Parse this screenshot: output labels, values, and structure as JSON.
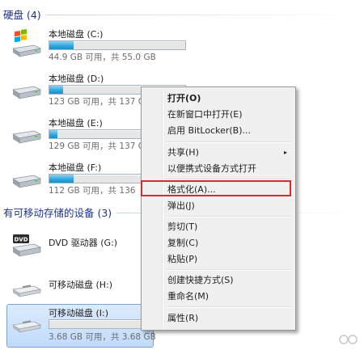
{
  "hard_disks": {
    "header": "硬盘 (4)",
    "drives": [
      {
        "name": "本地磁盘 (C:)",
        "space": "44.9 GB 可用，共 55.0 GB",
        "used_fraction": 0.18,
        "icon": "windows-drive-icon"
      },
      {
        "name": "本地磁盘 (D:)",
        "space": "123 GB 可用，共 137 G",
        "used_fraction": 0.1,
        "icon": "hard-drive-icon"
      },
      {
        "name": "本地磁盘 (E:)",
        "space": "129 GB 可用，共 137 G",
        "used_fraction": 0.06,
        "icon": "hard-drive-icon"
      },
      {
        "name": "本地磁盘 (F:)",
        "space": "112 GB 可用，共 136",
        "used_fraction": 0.18,
        "icon": "hard-drive-icon"
      }
    ]
  },
  "removable": {
    "header": "有可移动存储的设备 (3)",
    "devices": [
      {
        "name": "DVD 驱动器 (G:)",
        "icon": "dvd-drive-icon",
        "badge": "DVD"
      },
      {
        "name": "可移动磁盘 (H:)",
        "icon": "removable-drive-icon"
      },
      {
        "name": "可移动磁盘 (I:)",
        "space": "3.68 GB 可用，共 3.68 GB",
        "used_fraction": 0.0,
        "icon": "removable-drive-icon"
      }
    ]
  },
  "context_menu": {
    "items": [
      {
        "label": "打开(O)",
        "bold": true
      },
      {
        "label": "在新窗口中打开(E)"
      },
      {
        "label": "启用 BitLocker(B)..."
      },
      {
        "label": "共享(H)",
        "submenu": true
      },
      {
        "label": "以便携式设备方式打开"
      },
      {
        "label": "格式化(A)...",
        "highlighted": true
      },
      {
        "label": "弹出(J)"
      },
      {
        "label": "剪切(T)"
      },
      {
        "label": "复制(C)"
      },
      {
        "label": "粘贴(P)"
      },
      {
        "label": "创建快捷方式(S)"
      },
      {
        "label": "重命名(M)"
      },
      {
        "label": "属性(R)"
      }
    ],
    "submenu_arrow": "▸"
  },
  "colors": {
    "header_text": "#1e3287",
    "bar_fill": "#29a6df",
    "highlight_border": "#d92a2a"
  }
}
